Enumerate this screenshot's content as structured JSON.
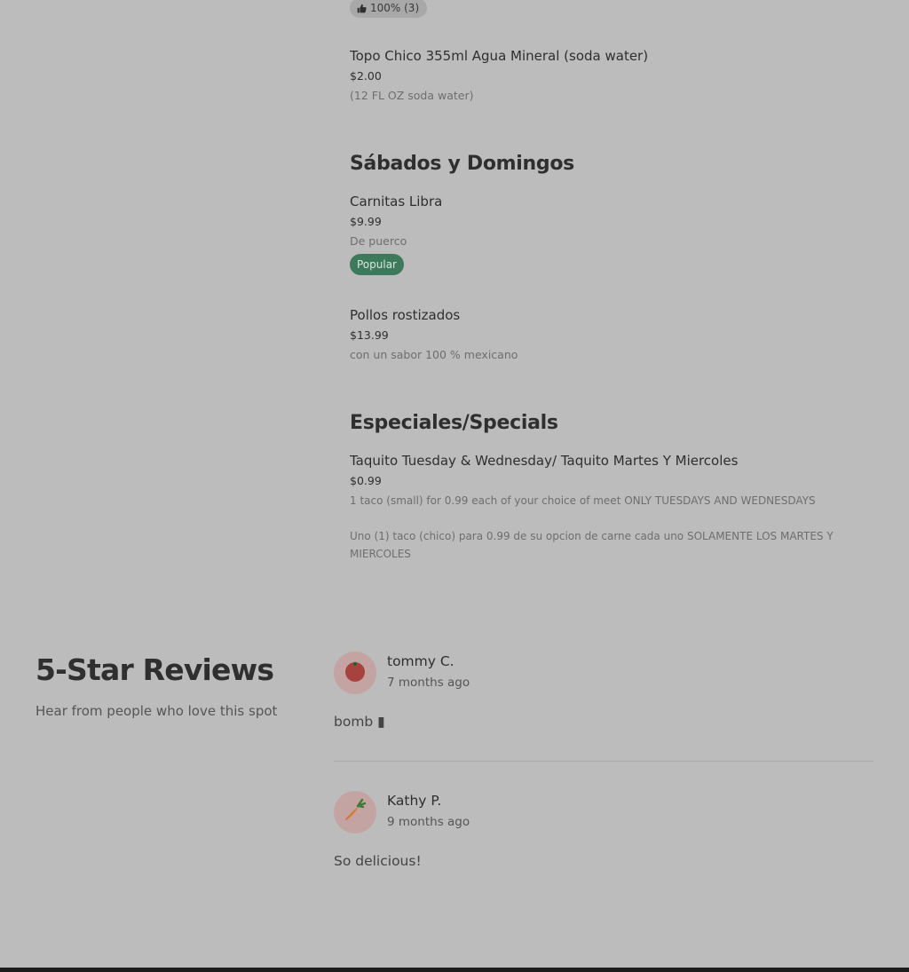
{
  "rating_pill": {
    "icon": "thumbs-up-icon",
    "text": "100% (3)"
  },
  "items": {
    "topo_chico": {
      "name": "Topo Chico 355ml Agua Mineral (soda water)",
      "price": "$2.00",
      "description": "(12 FL OZ soda water)"
    },
    "carnitas": {
      "name": "Carnitas Libra",
      "price": "$9.99",
      "description": "De puerco",
      "badge": "Popular"
    },
    "pollos": {
      "name": "Pollos rostizados",
      "price": "$13.99",
      "description": "con un sabor 100 % mexicano"
    },
    "taquito": {
      "name": "Taquito Tuesday & Wednesday/ Taquito Martes Y Miercoles",
      "price": "$0.99",
      "description": "1 taco (small) for 0.99 each of your choice of meet ONLY TUESDAYS AND WEDNESDAYS",
      "description_es": "Uno (1) taco (chico) para 0.99 de su opcion de carne cada uno SOLAMENTE LOS MARTES Y MIERCOLES"
    }
  },
  "sections": {
    "weekend": "Sábados y Domingos",
    "specials": "Especiales/Specials"
  },
  "reviews_section": {
    "title": "5-Star Reviews",
    "subtitle": "Hear from people who love this spot",
    "reviews": [
      {
        "name": "tommy C.",
        "time": "7 months ago",
        "text": "bomb ▮",
        "avatar_icon": "tomato-icon"
      },
      {
        "name": "Kathy P.",
        "time": "9 months ago",
        "text": "So delicious!",
        "avatar_icon": "carrot-icon"
      }
    ]
  },
  "colors": {
    "background": "#bcbcbc",
    "popular_badge": "#3d7a5b",
    "avatar_bg": "#c4a3a3"
  }
}
